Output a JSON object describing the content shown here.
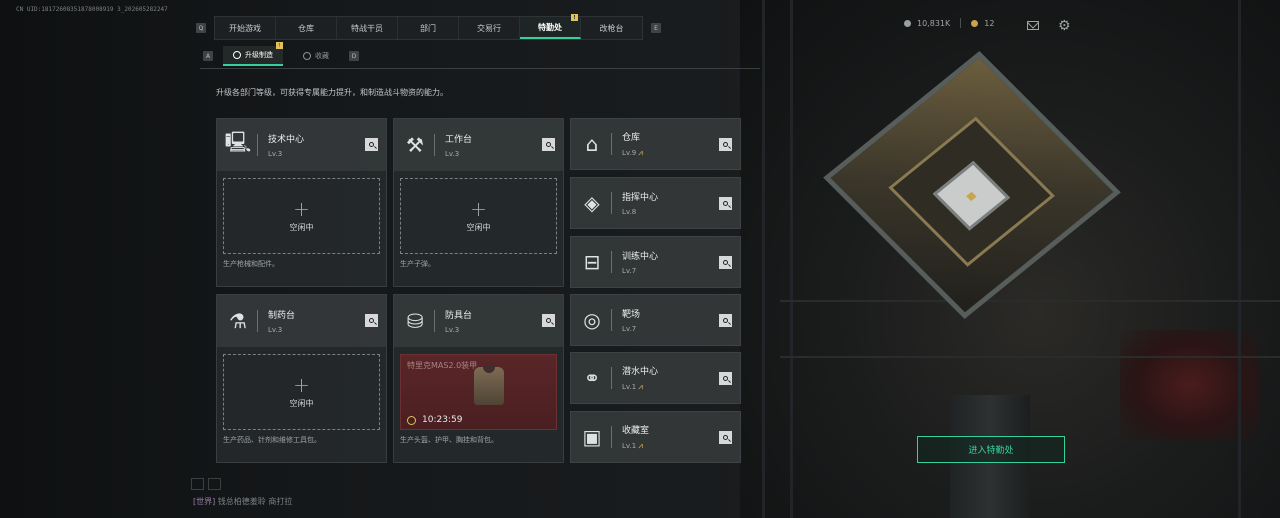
{
  "build_id": "CN UID:18172608351878008919 3_202605282247",
  "top_tabs": {
    "items": [
      {
        "label": "开始游戏"
      },
      {
        "label": "仓库"
      },
      {
        "label": "特战干员"
      },
      {
        "label": "部门"
      },
      {
        "label": "交易行"
      },
      {
        "label": "特勤处",
        "active": true,
        "badge": "!"
      },
      {
        "label": "改枪台"
      }
    ],
    "prev_key": "Q",
    "next_key": "E"
  },
  "status": {
    "currency": "10,831K",
    "tickets": "12"
  },
  "sub_tabs": {
    "items": [
      {
        "label": "升级制造",
        "active": true,
        "badge": "!"
      },
      {
        "label": "收藏"
      }
    ],
    "prev_key": "A",
    "next_key": "D"
  },
  "description": "升级各部门等级，可获得专属能力提升，和制造战斗物资的能力。",
  "production_cards": [
    {
      "name": "技术中心",
      "level": "Lv.3",
      "icon": "computer-icon",
      "slot_status": "空闲中",
      "footer": "生产枪械和配件。"
    },
    {
      "name": "工作台",
      "level": "Lv.3",
      "icon": "tools-icon",
      "slot_status": "空闲中",
      "footer": "生产子弹。"
    },
    {
      "name": "制药台",
      "level": "Lv.3",
      "icon": "microscope-icon",
      "slot_status": "空闲中",
      "footer": "生产药品、针剂和维修工具包。"
    },
    {
      "name": "防具台",
      "level": "Lv.3",
      "icon": "armor-icon",
      "craft_item": "特里克MAS2.0装甲",
      "craft_timer": "10:23:59",
      "footer": "生产头盔、护甲、胸挂和背包。"
    }
  ],
  "facilities": [
    {
      "name": "仓库",
      "level": "Lv.9",
      "icon": "warehouse-icon",
      "upgradable": true
    },
    {
      "name": "指挥中心",
      "level": "Lv.8",
      "icon": "command-chip-icon",
      "upgradable": false
    },
    {
      "name": "训练中心",
      "level": "Lv.7",
      "icon": "dumbbell-icon",
      "upgradable": false
    },
    {
      "name": "靶场",
      "level": "Lv.7",
      "icon": "target-icon",
      "upgradable": false
    },
    {
      "name": "潜水中心",
      "level": "Lv.1",
      "icon": "diving-mask-icon",
      "upgradable": true
    },
    {
      "name": "收藏室",
      "level": "Lv.1",
      "icon": "collection-icon",
      "upgradable": true
    }
  ],
  "enter_button": "进入特勤处",
  "chat": {
    "channel": "[世界]",
    "message": "钱总柏德羞聆 商打拉"
  },
  "colors": {
    "accent": "#35d19a",
    "badge": "#e3c15a",
    "craft_bg": "#5a2628"
  }
}
